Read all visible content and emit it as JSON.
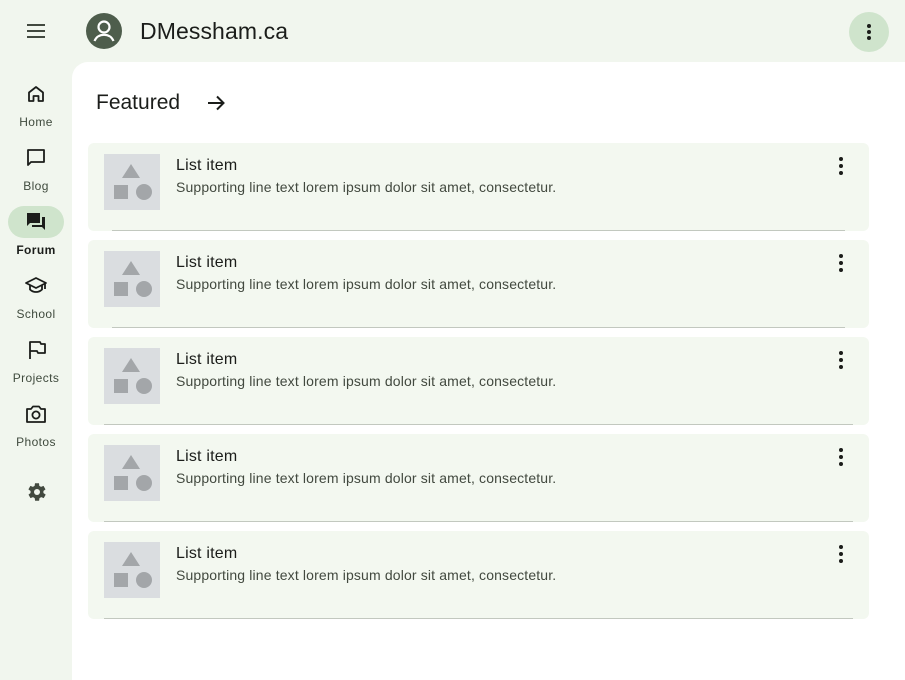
{
  "app_bar": {
    "title": "DMessham.ca",
    "menu_icon": "menu-icon",
    "avatar_icon": "account-icon",
    "more_icon": "more-vert-icon"
  },
  "colors": {
    "background": "#f1f6ee",
    "surface": "#ffffff",
    "accent": "#cfe4cc",
    "list_item_bg": "#f3f8f0",
    "thumbnail": "#dadde0"
  },
  "nav_rail": {
    "items": [
      {
        "label": "Home",
        "icon": "home-icon",
        "active": false
      },
      {
        "label": "Blog",
        "icon": "chat-bubble-icon",
        "active": false
      },
      {
        "label": "Forum",
        "icon": "forum-icon",
        "active": true
      },
      {
        "label": "School",
        "icon": "school-icon",
        "active": false
      },
      {
        "label": "Projects",
        "icon": "flag-icon",
        "active": false
      },
      {
        "label": "Photos",
        "icon": "camera-icon",
        "active": false
      }
    ],
    "settings_icon": "gear-icon"
  },
  "section": {
    "title": "Featured",
    "arrow_icon": "arrow-forward-icon"
  },
  "list": {
    "items": [
      {
        "title": "List item",
        "supporting": "Supporting line text lorem ipsum dolor sit amet, consectetur."
      },
      {
        "title": "List item",
        "supporting": "Supporting line text lorem ipsum dolor sit amet, consectetur."
      },
      {
        "title": "List item",
        "supporting": "Supporting line text lorem ipsum dolor sit amet, consectetur."
      },
      {
        "title": "List item",
        "supporting": "Supporting line text lorem ipsum dolor sit amet, consectetur."
      },
      {
        "title": "List item",
        "supporting": "Supporting line text lorem ipsum dolor sit amet, consectetur."
      }
    ]
  }
}
